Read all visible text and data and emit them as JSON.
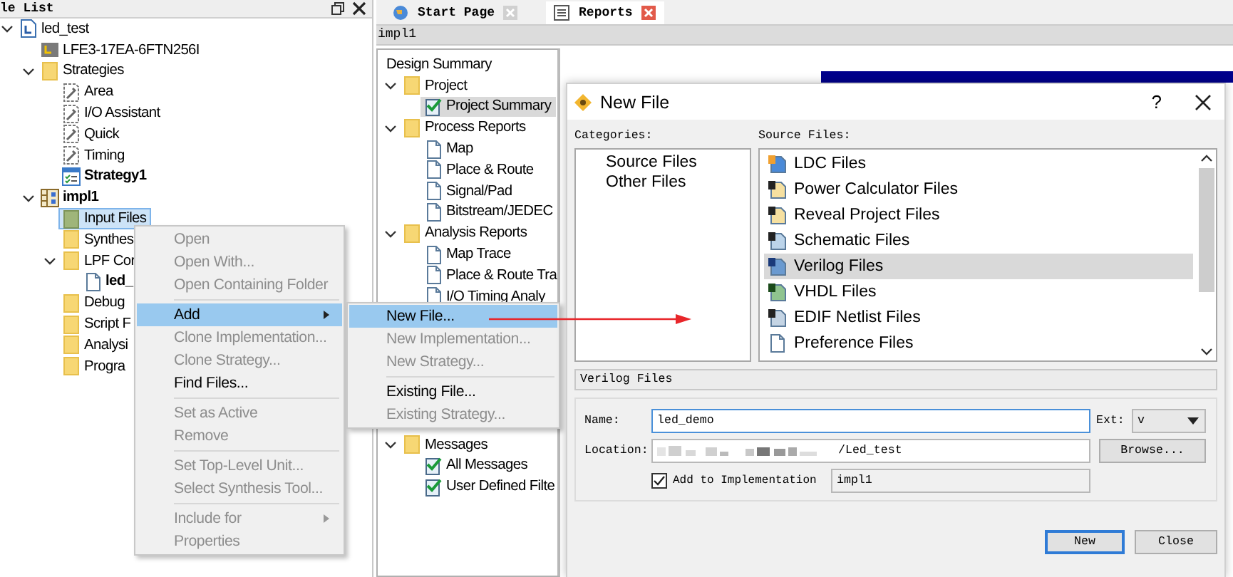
{
  "file_list_panel": {
    "title": "le List",
    "tree": [
      {
        "label": "led_test",
        "kind": "project",
        "expanded": true,
        "selected": false,
        "children": [
          {
            "label": "LFE3-17EA-6FTN256I",
            "kind": "device",
            "selected": false
          },
          {
            "label": "Strategies",
            "kind": "folder",
            "expanded": true,
            "selected": false,
            "children": [
              {
                "label": "Area",
                "kind": "strategy",
                "selected": false
              },
              {
                "label": "I/O Assistant",
                "kind": "strategy",
                "selected": false
              },
              {
                "label": "Quick",
                "kind": "strategy",
                "selected": false
              },
              {
                "label": "Timing",
                "kind": "strategy",
                "selected": false
              },
              {
                "label": "Strategy1",
                "kind": "strategy-active",
                "selected": false,
                "bold": true
              }
            ]
          },
          {
            "label": "impl1",
            "kind": "implementation",
            "expanded": true,
            "selected": false,
            "bold": true,
            "children": [
              {
                "label": "Input Files",
                "kind": "folder-input",
                "selected": true
              },
              {
                "label": "Synthes",
                "kind": "folder",
                "selected": false
              },
              {
                "label": "LPF Cor",
                "kind": "folder",
                "expanded": true,
                "selected": false,
                "children": [
                  {
                    "label": "led_",
                    "kind": "file",
                    "selected": false,
                    "bold": true
                  }
                ]
              },
              {
                "label": "Debug",
                "kind": "folder",
                "selected": false
              },
              {
                "label": "Script F",
                "kind": "folder",
                "selected": false
              },
              {
                "label": "Analysi",
                "kind": "folder",
                "selected": false
              },
              {
                "label": "Progra",
                "kind": "folder",
                "selected": false
              }
            ]
          }
        ]
      }
    ]
  },
  "tabs": [
    {
      "label": "Start Page",
      "selected": false
    },
    {
      "label": "Reports",
      "selected": true
    }
  ],
  "implementation_bar": "impl1",
  "design_summary": {
    "tree": [
      {
        "label": "Design Summary",
        "kind": "root",
        "selected": false
      },
      {
        "label": "Project",
        "kind": "folder",
        "expanded": true,
        "selected": false,
        "children": [
          {
            "label": "Project Summary",
            "kind": "check",
            "selected": true
          }
        ]
      },
      {
        "label": "Process Reports",
        "kind": "folder",
        "expanded": true,
        "selected": false,
        "children": [
          {
            "label": "Map",
            "kind": "file",
            "selected": false
          },
          {
            "label": "Place & Route",
            "kind": "file",
            "selected": false
          },
          {
            "label": "Signal/Pad",
            "kind": "file",
            "selected": false
          },
          {
            "label": "Bitstream/JEDEC",
            "kind": "file",
            "selected": false
          }
        ]
      },
      {
        "label": "Analysis Reports",
        "kind": "folder",
        "expanded": true,
        "selected": false,
        "children": [
          {
            "label": "Map Trace",
            "kind": "file",
            "selected": false
          },
          {
            "label": "Place & Route Tra",
            "kind": "file",
            "selected": false
          },
          {
            "label": "I/O Timing Analy",
            "kind": "file",
            "selected": false
          }
        ]
      }
    ],
    "tree_lower": [
      {
        "label": "Messages",
        "kind": "folder",
        "expanded": true,
        "selected": false,
        "children": [
          {
            "label": "All Messages",
            "kind": "check",
            "selected": false
          },
          {
            "label": "User Defined Filte",
            "kind": "check",
            "selected": false
          }
        ]
      }
    ]
  },
  "context_menu": {
    "groups": [
      [
        {
          "label": "Open",
          "disabled": true,
          "selected": false,
          "submenu": false
        },
        {
          "label": "Open With...",
          "disabled": true,
          "selected": false,
          "submenu": false
        },
        {
          "label": "Open Containing Folder",
          "disabled": true,
          "selected": false,
          "submenu": false
        }
      ],
      [
        {
          "label": "Add",
          "disabled": false,
          "selected": true,
          "submenu": true
        },
        {
          "label": "Clone Implementation...",
          "disabled": true,
          "selected": false,
          "submenu": false
        },
        {
          "label": "Clone Strategy...",
          "disabled": true,
          "selected": false,
          "submenu": false
        },
        {
          "label": "Find Files...",
          "disabled": false,
          "selected": false,
          "submenu": false
        }
      ],
      [
        {
          "label": "Set as Active",
          "disabled": true,
          "selected": false,
          "submenu": false
        },
        {
          "label": "Remove",
          "disabled": true,
          "selected": false,
          "submenu": false
        }
      ],
      [
        {
          "label": "Set Top-Level Unit...",
          "disabled": true,
          "selected": false,
          "submenu": false
        },
        {
          "label": "Select Synthesis Tool...",
          "disabled": true,
          "selected": false,
          "submenu": false
        }
      ],
      [
        {
          "label": "Include for",
          "disabled": true,
          "selected": false,
          "submenu": true
        },
        {
          "label": "Properties",
          "disabled": true,
          "selected": false,
          "submenu": false
        }
      ]
    ]
  },
  "submenu": {
    "groups": [
      [
        {
          "label": "New File...",
          "disabled": false,
          "selected": true,
          "submenu": false
        },
        {
          "label": "New Implementation...",
          "disabled": true,
          "selected": false,
          "submenu": false
        },
        {
          "label": "New Strategy...",
          "disabled": true,
          "selected": false,
          "submenu": false
        }
      ],
      [
        {
          "label": "Existing File...",
          "disabled": false,
          "selected": false,
          "submenu": false
        },
        {
          "label": "Existing Strategy...",
          "disabled": true,
          "selected": false,
          "submenu": false
        }
      ]
    ]
  },
  "dialog": {
    "title": "New File",
    "help": "?",
    "categories_label": "Categories:",
    "categories": [
      {
        "label": "Source Files",
        "selected": false
      },
      {
        "label": "Other Files",
        "selected": false
      }
    ],
    "source_files_label": "Source Files:",
    "source_files": [
      {
        "label": "LDC Files",
        "kind": "ldc",
        "selected": false
      },
      {
        "label": "Power Calculator Files",
        "kind": "power",
        "selected": false
      },
      {
        "label": "Reveal Project Files",
        "kind": "reveal",
        "selected": false
      },
      {
        "label": "Schematic Files",
        "kind": "schematic",
        "selected": false
      },
      {
        "label": "Verilog Files",
        "kind": "verilog",
        "selected": true
      },
      {
        "label": "VHDL Files",
        "kind": "vhdl",
        "selected": false
      },
      {
        "label": "EDIF Netlist Files",
        "kind": "edif",
        "selected": false
      },
      {
        "label": "Preference Files",
        "kind": "preference",
        "selected": false
      }
    ],
    "description": "Verilog Files",
    "name_label": "Name:",
    "name_value": "led_demo",
    "ext_label": "Ext:",
    "ext_value": "v",
    "location_label": "Location:",
    "location_value": "/Led_test",
    "browse_button": "Browse...",
    "add_to_impl": {
      "label": "Add to Implementation",
      "checked": true,
      "value": "impl1"
    },
    "buttons": [
      {
        "label": "New",
        "default": true
      },
      {
        "label": "Close",
        "default": false
      }
    ]
  }
}
